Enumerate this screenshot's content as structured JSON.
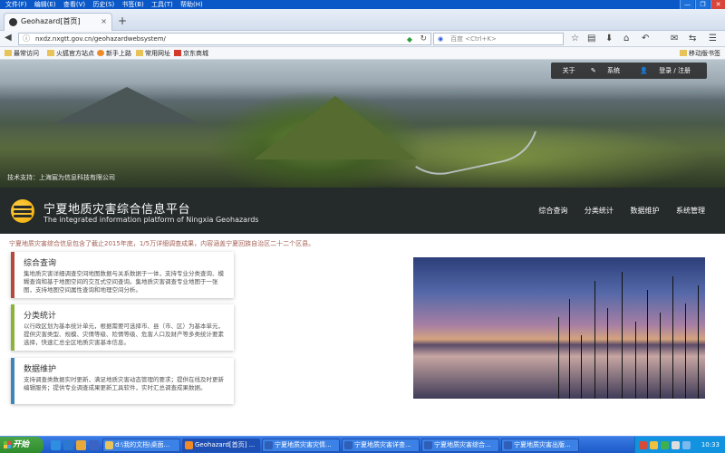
{
  "menubar": {
    "items": [
      "文件(F)",
      "编辑(E)",
      "查看(V)",
      "历史(S)",
      "书签(B)",
      "工具(T)",
      "帮助(H)"
    ],
    "window_controls": [
      "—",
      "❐",
      "✕"
    ]
  },
  "tab": {
    "title": "Geohazard[首页]",
    "close": "×",
    "new_tab": "+"
  },
  "address": {
    "url": "nxdz.nxgtt.gov.cn/geohazardwebsystem/",
    "search_placeholder": "百度 <Ctrl+K>"
  },
  "bookmarks": {
    "items": [
      "最常访问",
      "火狐官方站点",
      "新手上路",
      "常用网址",
      "京东商城"
    ],
    "right": "移动版书签"
  },
  "hero": {
    "credit": "技术支持：上海宸为信息科技有限公司"
  },
  "topmenu": {
    "about": "关于",
    "system": "系统",
    "login": "登录 / 注册"
  },
  "header": {
    "title_cn": "宁夏地质灾害综合信息平台",
    "title_en": "The integrated information platform of Ningxia Geohazards",
    "nav": [
      "综合查询",
      "分类统计",
      "数据维护",
      "系统管理"
    ]
  },
  "intro": "宁夏地质灾害综合信息包含了截止2015年底，1/5万详细调查成果，内容涵盖宁夏回族自治区二十二个区县。",
  "cards": [
    {
      "title": "综合查询",
      "text": "集地质灾害详细调查空间地图数据与关系数据于一体，支持专业分类查询、模糊查询和基于地图空间的交互式空间查询。集地质灾害调查专业地图于一张图，支持地图空间属性查询和地理空间分析。"
    },
    {
      "title": "分类统计",
      "text": "以行政区划为基本统计单元，根据需要可选择市、县（市、区）为基本单元，提供灾害类型、规模、灾情等级、险情等级、危害人口及财产等多类统计要素选择，快速汇总全区地质灾害基本信息。"
    },
    {
      "title": "数据维护",
      "text": "支持调查类数据实时更新，满足地质灾害动态管理的要求；提供在线及时更新编辑服务；提供专业调查成果更新工具软件，实时汇总调查成果数据。"
    }
  ],
  "taskbar": {
    "start": "开始",
    "tasks": [
      "d:\\我的文档\\桌面...",
      "Geohazard[首页] ...",
      "宁夏地质灾害灾情...",
      "宁夏地质灾害详查...",
      "宁夏地质灾害综合...",
      "宁夏地质灾害出版..."
    ],
    "clock": "10:33"
  }
}
